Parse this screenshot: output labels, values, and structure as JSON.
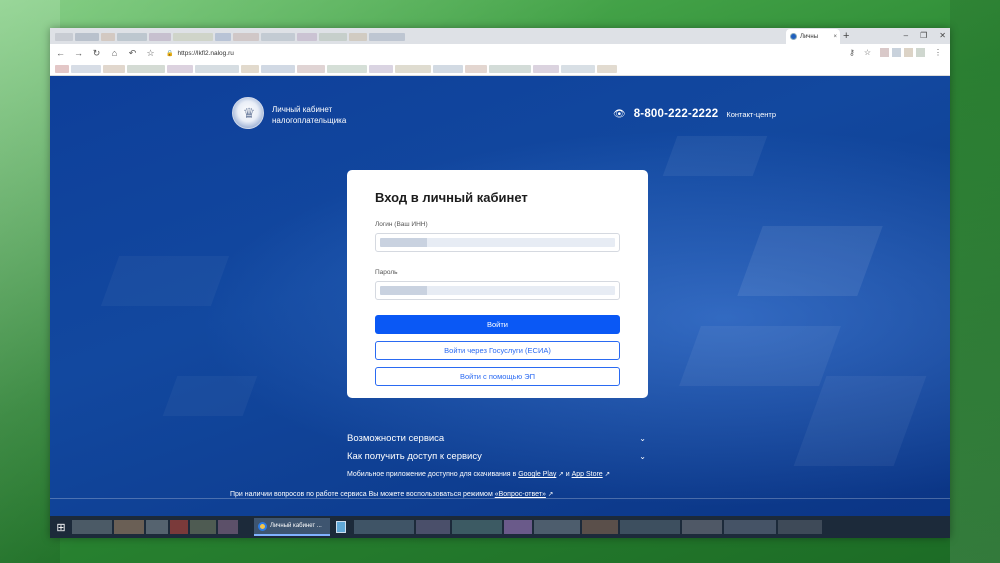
{
  "browser": {
    "tab_title": "Личны",
    "tab_close": "×",
    "new_tab": "+",
    "url": "https://lkfl2.nalog.ru",
    "win_min": "–",
    "win_max": "❐",
    "win_close": "✕"
  },
  "header": {
    "logo_line1": "Личный кабинет",
    "logo_line2": "налогоплательщика",
    "phone": "8-800-222-2222",
    "contact_label": "Контакт-центр"
  },
  "login": {
    "title": "Вход в личный кабинет",
    "login_label": "Логин (Ваш ИНН)",
    "password_label": "Пароль",
    "submit_label": "Войти",
    "gosuslugi_label": "Войти через Госуслуги (ЕСИА)",
    "ep_label": "Войти с помощью ЭП"
  },
  "info": {
    "features": "Возможности сервиса",
    "access": "Как получить доступ к сервису",
    "mobile_prefix": "Мобильное приложение доступно для скачивания в ",
    "google_play": "Google Play",
    "and": " и ",
    "app_store": "App Store",
    "footer_prefix": "При наличии вопросов по работе сервиса Вы можете воспользоваться режимом ",
    "footer_link": "«Вопрос-ответ»"
  },
  "taskbar": {
    "active_task": "Личный кабинет ..."
  },
  "colors": {
    "primary": "#0a58f5",
    "page_bg": "#12489f"
  }
}
